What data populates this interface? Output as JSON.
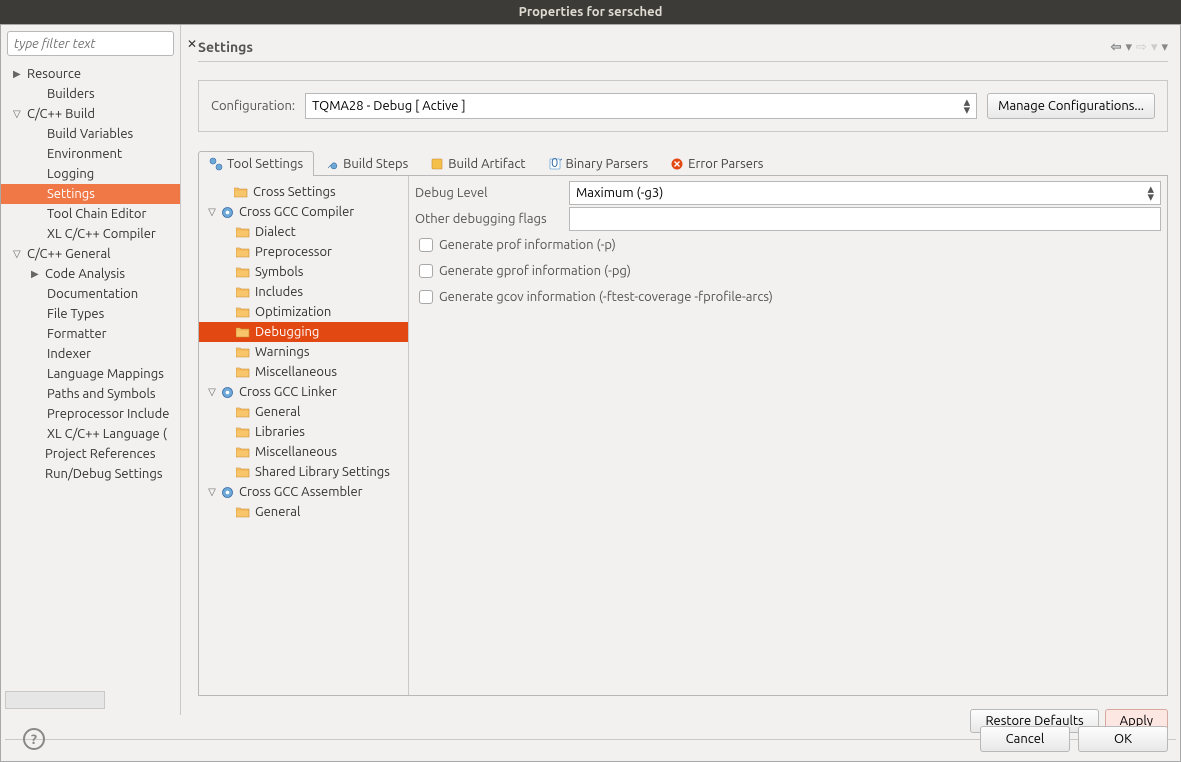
{
  "title": "Properties for sersched",
  "filter": {
    "placeholder": "type filter text"
  },
  "navTree": [
    {
      "label": "Resource",
      "indent": 0,
      "tw": "▶",
      "sel": false
    },
    {
      "label": "Builders",
      "indent": 1,
      "tw": "",
      "sel": false
    },
    {
      "label": "C/C++ Build",
      "indent": 0,
      "tw": "▽",
      "sel": false
    },
    {
      "label": "Build Variables",
      "indent": 1,
      "tw": "",
      "sel": false
    },
    {
      "label": "Environment",
      "indent": 1,
      "tw": "",
      "sel": false
    },
    {
      "label": "Logging",
      "indent": 1,
      "tw": "",
      "sel": false
    },
    {
      "label": "Settings",
      "indent": 1,
      "tw": "",
      "sel": true
    },
    {
      "label": "Tool Chain Editor",
      "indent": 1,
      "tw": "",
      "sel": false
    },
    {
      "label": "XL C/C++ Compiler",
      "indent": 1,
      "tw": "",
      "sel": false
    },
    {
      "label": "C/C++ General",
      "indent": 0,
      "tw": "▽",
      "sel": false
    },
    {
      "label": "Code Analysis",
      "indent": 1,
      "tw": "▶",
      "sel": false
    },
    {
      "label": "Documentation",
      "indent": 1,
      "tw": "",
      "sel": false
    },
    {
      "label": "File Types",
      "indent": 1,
      "tw": "",
      "sel": false
    },
    {
      "label": "Formatter",
      "indent": 1,
      "tw": "",
      "sel": false
    },
    {
      "label": "Indexer",
      "indent": 1,
      "tw": "",
      "sel": false
    },
    {
      "label": "Language Mappings",
      "indent": 1,
      "tw": "",
      "sel": false
    },
    {
      "label": "Paths and Symbols",
      "indent": 1,
      "tw": "",
      "sel": false
    },
    {
      "label": "Preprocessor Include",
      "indent": 1,
      "tw": "",
      "sel": false
    },
    {
      "label": "XL C/C++ Language (",
      "indent": 1,
      "tw": "",
      "sel": false
    },
    {
      "label": "Project References",
      "indent": 0,
      "tw": "",
      "sel": false,
      "notoggle": true
    },
    {
      "label": "Run/Debug Settings",
      "indent": 0,
      "tw": "",
      "sel": false,
      "notoggle": true
    }
  ],
  "section": {
    "title": "Settings"
  },
  "config": {
    "label": "Configuration:",
    "value": "TQMA28 - Debug  [ Active ]",
    "manage": "Manage Configurations..."
  },
  "tabs": [
    {
      "label": "Tool Settings",
      "icon": "tools",
      "active": true
    },
    {
      "label": "Build Steps",
      "icon": "wrench",
      "active": false
    },
    {
      "label": "Build Artifact",
      "icon": "artifact",
      "active": false
    },
    {
      "label": "Binary Parsers",
      "icon": "binary",
      "active": false
    },
    {
      "label": "Error Parsers",
      "icon": "error",
      "active": false
    }
  ],
  "toolTree": [
    {
      "label": "Cross Settings",
      "level": 0,
      "icon": "folder",
      "tw": ""
    },
    {
      "label": "Cross GCC Compiler",
      "level": 0,
      "icon": "gear",
      "tw": "▽"
    },
    {
      "label": "Dialect",
      "level": 2,
      "icon": "folder",
      "tw": ""
    },
    {
      "label": "Preprocessor",
      "level": 2,
      "icon": "folder",
      "tw": ""
    },
    {
      "label": "Symbols",
      "level": 2,
      "icon": "folder",
      "tw": ""
    },
    {
      "label": "Includes",
      "level": 2,
      "icon": "folder",
      "tw": ""
    },
    {
      "label": "Optimization",
      "level": 2,
      "icon": "folder",
      "tw": ""
    },
    {
      "label": "Debugging",
      "level": 2,
      "icon": "folder",
      "tw": "",
      "sel": true
    },
    {
      "label": "Warnings",
      "level": 2,
      "icon": "folder",
      "tw": ""
    },
    {
      "label": "Miscellaneous",
      "level": 2,
      "icon": "folder",
      "tw": ""
    },
    {
      "label": "Cross GCC Linker",
      "level": 0,
      "icon": "gear",
      "tw": "▽"
    },
    {
      "label": "General",
      "level": 2,
      "icon": "folder",
      "tw": ""
    },
    {
      "label": "Libraries",
      "level": 2,
      "icon": "folder",
      "tw": ""
    },
    {
      "label": "Miscellaneous",
      "level": 2,
      "icon": "folder",
      "tw": ""
    },
    {
      "label": "Shared Library Settings",
      "level": 2,
      "icon": "folder",
      "tw": ""
    },
    {
      "label": "Cross GCC Assembler",
      "level": 0,
      "icon": "gear",
      "tw": "▽"
    },
    {
      "label": "General",
      "level": 2,
      "icon": "folder",
      "tw": ""
    }
  ],
  "form": {
    "debugLevel": {
      "label": "Debug Level",
      "value": "Maximum (-g3)"
    },
    "otherFlags": {
      "label": "Other debugging flags",
      "value": ""
    },
    "checks": [
      {
        "label": "Generate prof information (-p)"
      },
      {
        "label": "Generate gprof information (-pg)"
      },
      {
        "label": "Generate gcov information (-ftest-coverage -fprofile-arcs)"
      }
    ]
  },
  "actions": {
    "restore": "Restore Defaults",
    "apply": "Apply"
  },
  "dialog": {
    "cancel": "Cancel",
    "ok": "OK"
  }
}
